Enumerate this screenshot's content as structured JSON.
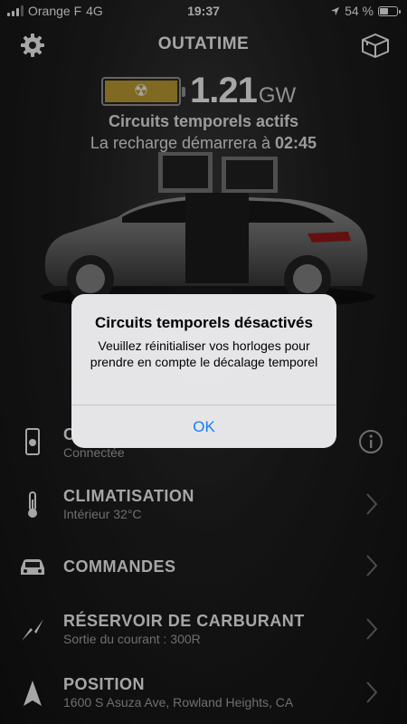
{
  "status_bar": {
    "carrier": "Orange F",
    "network": "4G",
    "time": "19:37",
    "battery_pct": "54 %",
    "battery_level": 0.54
  },
  "header": {
    "title": "OUTATIME",
    "settings_icon": "gear-icon",
    "box_icon": "box-icon"
  },
  "energy": {
    "value": "1.21",
    "unit": "GW",
    "icon": "radiation-icon",
    "bar_color": "#c5a232"
  },
  "status": {
    "line1": "Circuits temporels actifs",
    "line2_prefix": "La recharge démarrera à ",
    "line2_time": "02:45"
  },
  "menu": {
    "items": [
      {
        "title": "C",
        "subtitle": "Connectée",
        "icon": "phone-icon",
        "action_icon": "info-icon"
      },
      {
        "title": "CLIMATISATION",
        "subtitle": "Intérieur 32°C",
        "icon": "thermometer-icon"
      },
      {
        "title": "COMMANDES",
        "subtitle": "",
        "icon": "car-icon"
      },
      {
        "title": "RÉSERVOIR DE CARBURANT",
        "subtitle": "Sortie du courant : 300R",
        "icon": "lightning-icon"
      },
      {
        "title": "POSITION",
        "subtitle": "1600 S Asuza Ave, Rowland Heights, CA",
        "icon": "location-arrow-icon"
      }
    ]
  },
  "alert": {
    "title": "Circuits temporels désactivés",
    "message": "Veuillez réinitialiser vos horloges pour prendre en compte le décalage temporel",
    "ok_label": "OK",
    "ok_color": "#1b7cf4"
  }
}
